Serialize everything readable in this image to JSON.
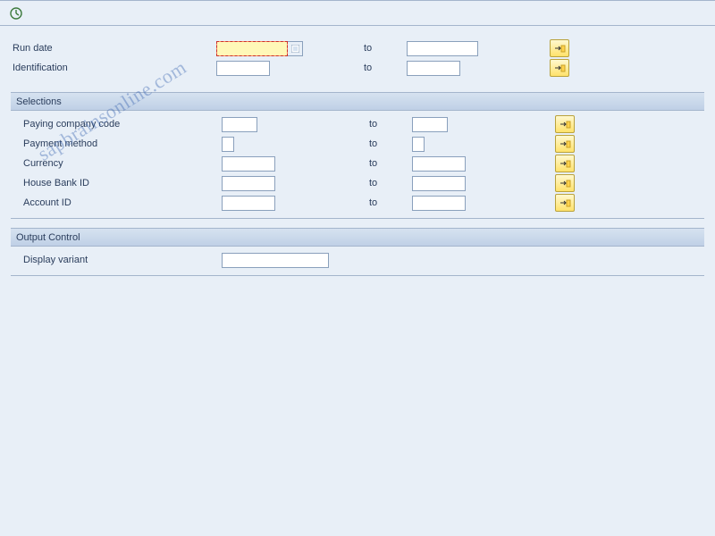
{
  "watermark": "sapbrainsonline.com",
  "toolbar": {
    "execute_title": "Execute (F8)"
  },
  "top": {
    "run_date_label": "Run date",
    "identification_label": "Identification",
    "to_label": "to"
  },
  "selections": {
    "title": "Selections",
    "to_label": "to",
    "rows": {
      "paying_cc": "Paying company code",
      "payment_method": "Payment method",
      "currency": "Currency",
      "house_bank": "House Bank ID",
      "account_id": "Account ID"
    }
  },
  "output_control": {
    "title": "Output Control",
    "display_variant": "Display variant"
  },
  "icons": {
    "multi": "Multiple selection"
  }
}
